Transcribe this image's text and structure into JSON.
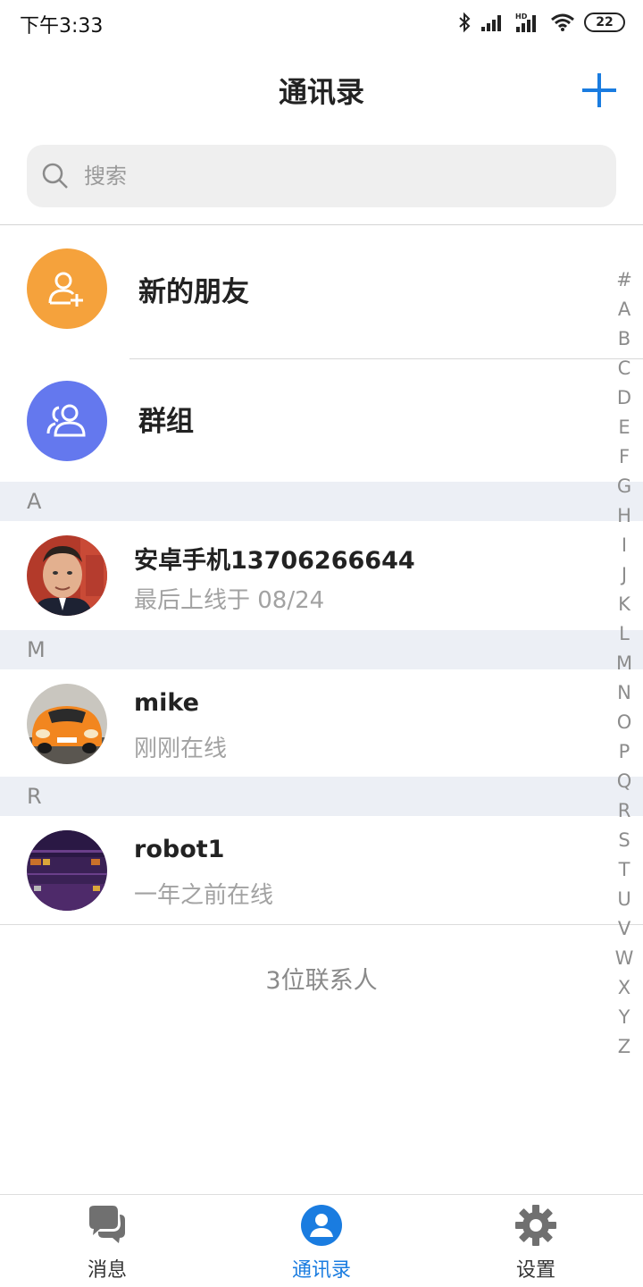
{
  "statusbar": {
    "time": "下午3:33",
    "battery": "22",
    "icons": [
      "bluetooth-icon",
      "signal-icon",
      "hd-signal-icon",
      "wifi-icon",
      "battery-icon"
    ]
  },
  "header": {
    "title": "通讯录",
    "add_icon": "plus-icon",
    "accent": "#1a7ce0"
  },
  "search": {
    "placeholder": "搜索",
    "icon": "search-icon"
  },
  "fixed_items": [
    {
      "label": "新的朋友",
      "icon": "add-user-icon",
      "color": "#f5a23c"
    },
    {
      "label": "群组",
      "icon": "group-icon",
      "color": "#6478ee"
    }
  ],
  "sections": [
    {
      "letter": "A",
      "contacts": [
        {
          "name": "安卓手机13706266644",
          "status": "最后上线于 08/24"
        }
      ]
    },
    {
      "letter": "M",
      "contacts": [
        {
          "name": "mike",
          "status": "刚刚在线"
        }
      ]
    },
    {
      "letter": "R",
      "contacts": [
        {
          "name": "robot1",
          "status": "一年之前在线"
        }
      ]
    }
  ],
  "contact_count": "3位联系人",
  "index_letters": [
    "#",
    "A",
    "B",
    "C",
    "D",
    "E",
    "F",
    "G",
    "H",
    "I",
    "J",
    "K",
    "L",
    "M",
    "N",
    "O",
    "P",
    "Q",
    "R",
    "S",
    "T",
    "U",
    "V",
    "W",
    "X",
    "Y",
    "Z"
  ],
  "tabs": [
    {
      "label": "消息",
      "icon": "chat-icon",
      "active": false
    },
    {
      "label": "通讯录",
      "icon": "contact-icon",
      "active": true
    },
    {
      "label": "设置",
      "icon": "gear-icon",
      "active": false
    }
  ]
}
